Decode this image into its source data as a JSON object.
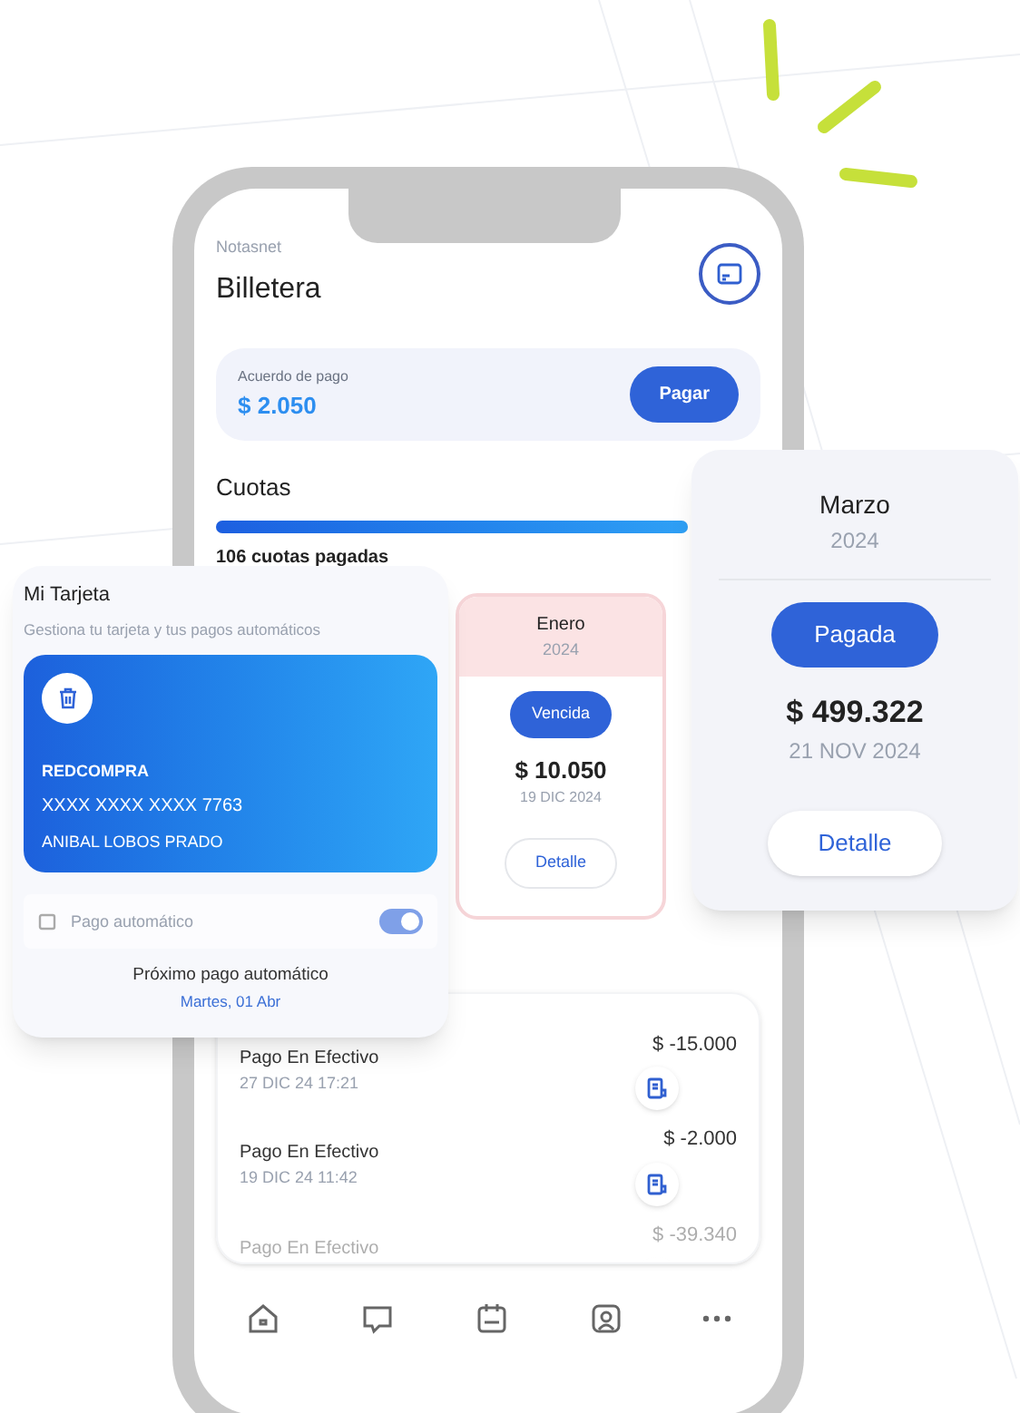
{
  "header": {
    "subtitle": "Notasnet",
    "title": "Billetera"
  },
  "payment_agreement": {
    "label": "Acuerdo de pago",
    "amount": "$ 2.050",
    "button": "Pagar"
  },
  "cuotas": {
    "title": "Cuotas",
    "level": 1,
    "summary": "106 cuotas pagadas",
    "items": [
      {
        "kind": "overdue",
        "month": "Enero",
        "year": "2024",
        "status": "Vencida",
        "amount": "$ 10.050",
        "date": "19 DIC 2024",
        "action": "Detalle"
      }
    ]
  },
  "featured_cuota": {
    "month": "Marzo",
    "year": "2024",
    "status": "Pagada",
    "amount": "$ 499.322",
    "date": "21 NOV 2024",
    "action": "Detalle"
  },
  "transactions": [
    {
      "title": "Pago En Efectivo",
      "date": "27 DIC 24 17:21",
      "amount": "$ -15.000",
      "faded": false
    },
    {
      "title": "Pago En Efectivo",
      "date": "19 DIC 24 11:42",
      "amount": "$ -2.000",
      "faded": false
    },
    {
      "title": "Pago En Efectivo",
      "amount": "$ -39.340",
      "faded": true
    }
  ],
  "my_card": {
    "title": "Mi Tarjeta",
    "subtitle": "Gestiona tu tarjeta y tus pagos automáticos",
    "network": "REDCOMPRA",
    "number": "XXXX XXXX XXXX 7763",
    "holder": "ANIBAL LOBOS PRADO",
    "auto_pay_label": "Pago automático",
    "auto_pay_on": true,
    "next_label": "Próximo pago automático",
    "next_date": "Martes, 01 Abr"
  }
}
